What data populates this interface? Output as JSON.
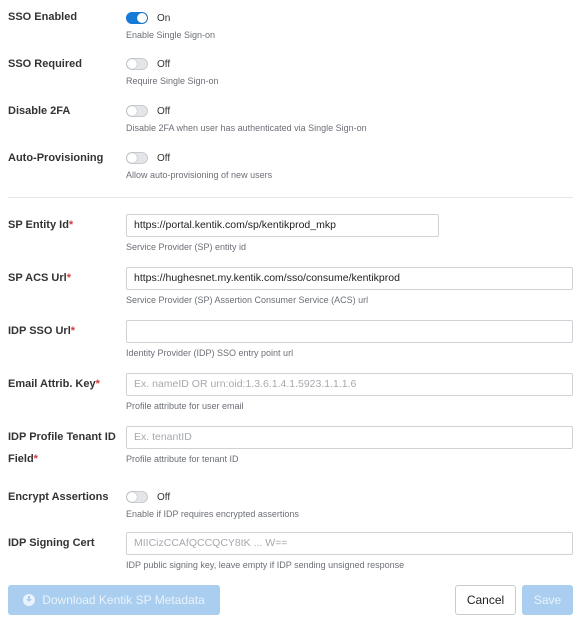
{
  "sso_enabled": {
    "label": "SSO Enabled",
    "state": "On",
    "help": "Enable Single Sign-on"
  },
  "sso_required": {
    "label": "SSO Required",
    "state": "Off",
    "help": "Require Single Sign-on"
  },
  "disable_2fa": {
    "label": "Disable 2FA",
    "state": "Off",
    "help": "Disable 2FA when user has authenticated via Single Sign-on"
  },
  "auto_provisioning": {
    "label": "Auto-Provisioning",
    "state": "Off",
    "help": "Allow auto-provisioning of new users"
  },
  "sp_entity_id": {
    "label": "SP Entity Id",
    "required": "*",
    "value": "https://portal.kentik.com/sp/kentikprod_mkp",
    "help": "Service Provider (SP) entity id"
  },
  "sp_acs_url": {
    "label": "SP ACS Url",
    "required": "*",
    "value": "https://hughesnet.my.kentik.com/sso/consume/kentikprod",
    "help": "Service Provider (SP) Assertion Consumer Service (ACS) url"
  },
  "idp_sso_url": {
    "label": "IDP SSO Url",
    "required": "*",
    "value": "",
    "help": "Identity Provider (IDP) SSO entry point url"
  },
  "email_attrib_key": {
    "label": "Email Attrib. Key",
    "required": "*",
    "placeholder": "Ex. nameID OR urn:oid:1.3.6.1.4.1.5923.1.1.1.6",
    "help": "Profile attribute for user email"
  },
  "idp_profile_tenant": {
    "label_line1": "IDP Profile Tenant ID",
    "label_line2": "Field",
    "required": "*",
    "placeholder": "Ex. tenantID",
    "help": "Profile attribute for tenant ID"
  },
  "encrypt_assertions": {
    "label": "Encrypt Assertions",
    "state": "Off",
    "help": "Enable if IDP requires encrypted assertions"
  },
  "idp_signing_cert": {
    "label": "IDP Signing Cert",
    "placeholder": "MIICizCCAfQCCQCY8tK ... W==",
    "help": "IDP public signing key, leave empty if IDP sending unsigned response"
  },
  "buttons": {
    "download": "Download Kentik SP Metadata",
    "cancel": "Cancel",
    "save": "Save"
  },
  "colors": {
    "toggle_on": "#157ad8",
    "primary_disabled": "#a9ceef",
    "required_marker": "#d63b3b"
  }
}
